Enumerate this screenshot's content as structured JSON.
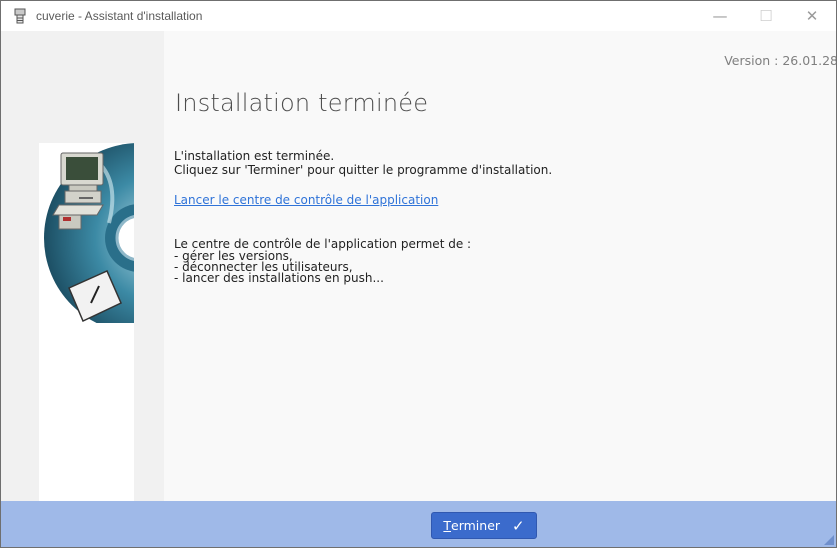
{
  "window": {
    "title": "cuverie - Assistant d'installation",
    "minimize_glyph": "—",
    "maximize_glyph": "☐",
    "close_glyph": "✕"
  },
  "main": {
    "version": "Version : 26.01.28",
    "heading": "Installation terminée",
    "intro_line1": "L'installation est terminée.",
    "intro_line2": "Cliquez sur 'Terminer' pour quitter le programme d'installation.",
    "link_label": "Lancer le centre de contrôle de l'application",
    "features_intro": "Le centre de contrôle de l'application permet de :",
    "features": [
      "- gérer les versions,",
      "- déconnecter les utilisateurs,",
      "- lancer des installations en push..."
    ]
  },
  "footer": {
    "finish_mnemonic": "T",
    "finish_rest": "erminer",
    "finish_check": "✓"
  },
  "colors": {
    "footer_bg": "#9fb9e8",
    "button_bg": "#3b6bcc",
    "link": "#2f73d8"
  }
}
